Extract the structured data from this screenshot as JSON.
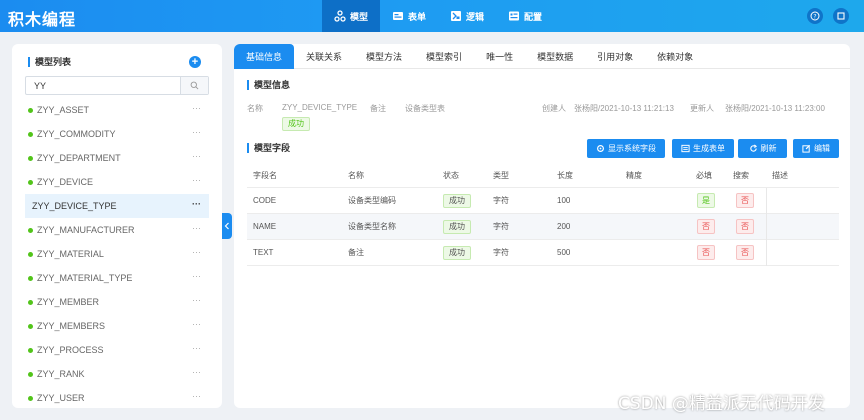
{
  "app": {
    "title": "积木编程"
  },
  "nav": [
    {
      "label": "模型",
      "icon": "model-icon",
      "active": true
    },
    {
      "label": "表单",
      "icon": "form-icon",
      "active": false
    },
    {
      "label": "逻辑",
      "icon": "logic-icon",
      "active": false
    },
    {
      "label": "配置",
      "icon": "config-icon",
      "active": false
    }
  ],
  "sidebar": {
    "title": "模型列表",
    "search": {
      "value": "YY",
      "placeholder": ""
    },
    "items": [
      {
        "label": "ZYY_ASSET"
      },
      {
        "label": "ZYY_COMMODITY"
      },
      {
        "label": "ZYY_DEPARTMENT"
      },
      {
        "label": "ZYY_DEVICE"
      },
      {
        "label": "ZYY_DEVICE_TYPE",
        "active": true
      },
      {
        "label": "ZYY_MANUFACTURER"
      },
      {
        "label": "ZYY_MATERIAL"
      },
      {
        "label": "ZYY_MATERIAL_TYPE"
      },
      {
        "label": "ZYY_MEMBER"
      },
      {
        "label": "ZYY_MEMBERS"
      },
      {
        "label": "ZYY_PROCESS"
      },
      {
        "label": "ZYY_RANK"
      },
      {
        "label": "ZYY_USER"
      }
    ],
    "more": "···"
  },
  "tabs": [
    "基础信息",
    "关联关系",
    "模型方法",
    "模型索引",
    "唯一性",
    "模型数据",
    "引用对象",
    "依赖对象"
  ],
  "model_info": {
    "title": "模型信息",
    "name_label": "名称",
    "name_value": "ZYY_DEVICE_TYPE",
    "remark_label": "备注",
    "remark_value": "设备类型表",
    "creator_label": "创建人",
    "creator_value": "张杨阳/2021-10-13 11:21:13",
    "updater_label": "更新人",
    "updater_value": "张杨阳/2021-10-13 11:23:00",
    "status": "成功"
  },
  "fields": {
    "title": "模型字段",
    "buttons": {
      "show_system": "显示系统字段",
      "generate_form": "生成表单",
      "refresh": "刷新",
      "edit": "编辑"
    },
    "columns": [
      "字段名",
      "名称",
      "状态",
      "类型",
      "长度",
      "精度",
      "必填",
      "搜索",
      "描述"
    ],
    "rows": [
      {
        "field": "CODE",
        "name": "设备类型编码",
        "status": "成功",
        "type": "字符",
        "length": "100",
        "precision": "",
        "required": "是",
        "search": "否",
        "desc": ""
      },
      {
        "field": "NAME",
        "name": "设备类型名称",
        "status": "成功",
        "type": "字符",
        "length": "200",
        "precision": "",
        "required": "否",
        "search": "否",
        "desc": ""
      },
      {
        "field": "TEXT",
        "name": "备注",
        "status": "成功",
        "type": "字符",
        "length": "500",
        "precision": "",
        "required": "否",
        "search": "否",
        "desc": ""
      }
    ]
  },
  "watermark": "CSDN @精益派无代码开发",
  "colors": {
    "primary": "#1b8cf0",
    "success": "#52c41a",
    "danger": "#e84d4d"
  }
}
